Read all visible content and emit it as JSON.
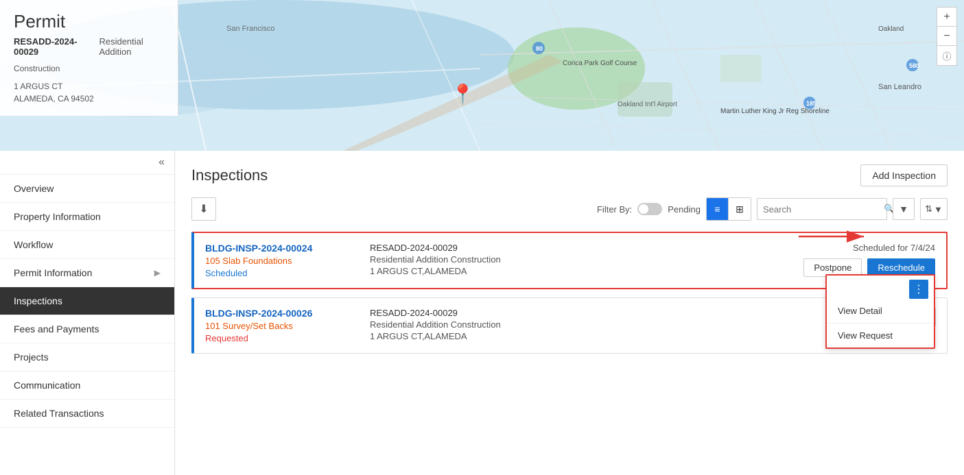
{
  "permit": {
    "title": "Permit",
    "id": "RESADD-2024-00029",
    "type": "Residential Addition",
    "category": "Construction",
    "address_line1": "1 ARGUS CT",
    "address_line2": "ALAMEDA, CA 94502"
  },
  "map": {
    "plus_label": "+",
    "minus_label": "−",
    "info_label": "ⓘ",
    "pin": "📍"
  },
  "sidebar": {
    "collapse_icon": "«",
    "items": [
      {
        "label": "Overview",
        "active": false,
        "has_chevron": false
      },
      {
        "label": "Property Information",
        "active": false,
        "has_chevron": false
      },
      {
        "label": "Workflow",
        "active": false,
        "has_chevron": false
      },
      {
        "label": "Permit Information",
        "active": false,
        "has_chevron": true
      },
      {
        "label": "Inspections",
        "active": true,
        "has_chevron": false
      },
      {
        "label": "Fees and Payments",
        "active": false,
        "has_chevron": false
      },
      {
        "label": "Projects",
        "active": false,
        "has_chevron": false
      },
      {
        "label": "Communication",
        "active": false,
        "has_chevron": false
      },
      {
        "label": "Related Transactions",
        "active": false,
        "has_chevron": false
      }
    ]
  },
  "inspections": {
    "title": "Inspections",
    "add_btn": "Add Inspection",
    "download_icon": "⬇",
    "filter_by_label": "Filter By:",
    "pending_label": "Pending",
    "search_placeholder": "Search",
    "filter_icon": "▼",
    "sort_icon": "⇅",
    "cards": [
      {
        "id": "BLDG-INSP-2024-00024",
        "description": "105 Slab Foundations",
        "status": "Scheduled",
        "status_type": "scheduled",
        "permit_id": "RESADD-2024-00029",
        "permit_type": "Residential Addition Construction",
        "address": "1 ARGUS CT,ALAMEDA",
        "scheduled_date": "Scheduled for 7/4/24",
        "has_postpone": true,
        "has_reschedule": true,
        "has_more": true,
        "highlighted": true,
        "show_dropdown": true,
        "dropdown_items": [
          "View Detail",
          "View Request"
        ]
      },
      {
        "id": "BLDG-INSP-2024-00026",
        "description": "101 Survey/Set Backs",
        "status": "Requested",
        "status_type": "requested",
        "permit_id": "RESADD-2024-00029",
        "permit_type": "Residential Addition Construction",
        "address": "1 ARGUS CT,ALAMEDA",
        "scheduled_date": "",
        "has_postpone": true,
        "has_reschedule": false,
        "has_more": false,
        "highlighted": false,
        "show_dropdown": false,
        "dropdown_items": []
      }
    ]
  }
}
